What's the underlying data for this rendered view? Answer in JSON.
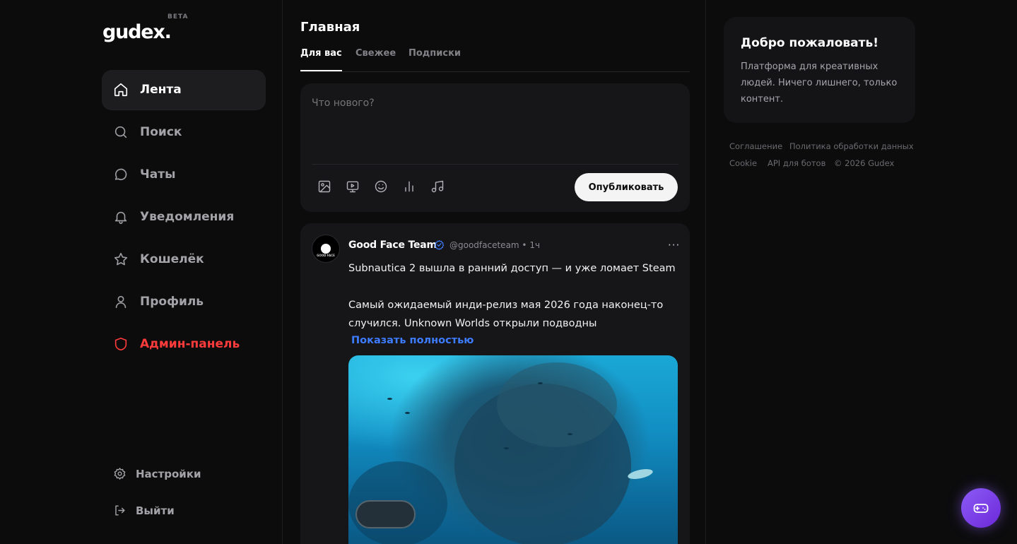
{
  "brand": {
    "logo": "gudex.",
    "badge": "BETA"
  },
  "sidebar": {
    "items": [
      {
        "label": "Лента",
        "icon": "home-icon",
        "active": true
      },
      {
        "label": "Поиск",
        "icon": "search-icon"
      },
      {
        "label": "Чаты",
        "icon": "chat-icon"
      },
      {
        "label": "Уведомления",
        "icon": "bell-icon"
      },
      {
        "label": "Кошелёк",
        "icon": "star-icon"
      },
      {
        "label": "Профиль",
        "icon": "user-icon"
      },
      {
        "label": "Админ-панель",
        "icon": "shield-icon",
        "color": "#ff3b3b"
      }
    ],
    "bottom": [
      {
        "label": "Настройки",
        "icon": "gear-icon"
      },
      {
        "label": "Выйти",
        "icon": "logout-icon"
      }
    ]
  },
  "feed": {
    "title": "Главная",
    "tabs": [
      {
        "label": "Для вас",
        "active": true
      },
      {
        "label": "Свежее"
      },
      {
        "label": "Подписки"
      }
    ],
    "composer": {
      "placeholder": "Что нового?",
      "tools": [
        "image-icon",
        "video-icon",
        "emoji-icon",
        "poll-icon",
        "music-icon"
      ],
      "publish_label": "Опубликовать"
    },
    "post": {
      "author": "Good Face Team",
      "avatar_text": "GOOD FACE",
      "handle": "@goodfaceteam • 1ч",
      "more": "···",
      "headline": "Subnautica 2 вышла в ранний доступ — и уже ломает Steam",
      "body": "Самый ожидаемый инди-релиз мая 2026 года наконец-то\nслучился. Unknown Worlds открыли подводны",
      "show_more": "Показать полностью"
    }
  },
  "right": {
    "welcome": {
      "title": "Добро пожаловать!",
      "text": "Платформа для креативных людей. Ничего лишнего, только контент."
    },
    "footer": {
      "agreement": "Соглашение",
      "privacy": "Политика обработки данных",
      "cookie": "Cookie",
      "api": "API для ботов",
      "copyright": "© 2026 Gudex"
    }
  },
  "colors": {
    "accent": "#3d7cff",
    "danger": "#ff3b3b",
    "fab": "#8b5cf6",
    "background": "#0c0c0d"
  }
}
